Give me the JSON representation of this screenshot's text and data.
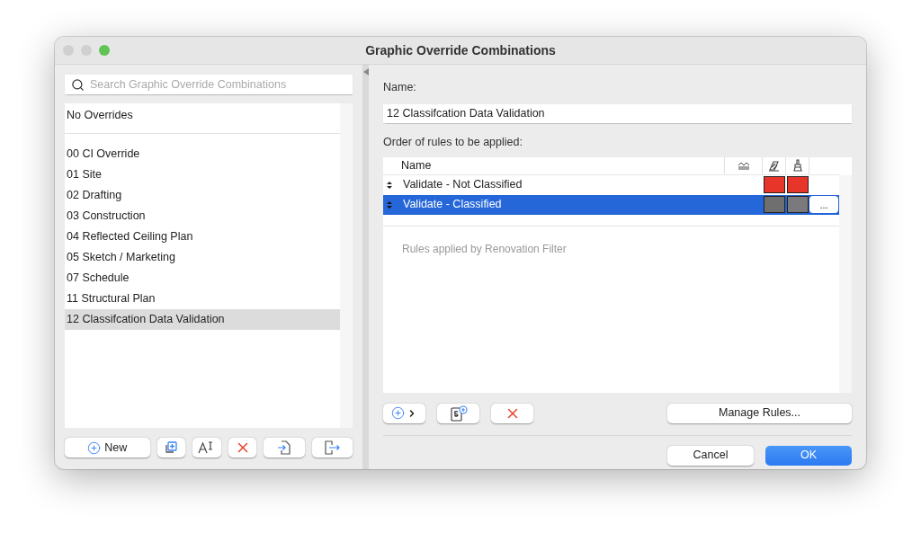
{
  "window": {
    "title": "Graphic Override Combinations"
  },
  "search": {
    "placeholder": "Search Graphic Override Combinations"
  },
  "combinations": [
    {
      "label": "No Overrides",
      "selected": false,
      "kind": "special"
    },
    {
      "label": "00 CI Override",
      "selected": false,
      "kind": "item"
    },
    {
      "label": "01 Site",
      "selected": false,
      "kind": "item"
    },
    {
      "label": "02 Drafting",
      "selected": false,
      "kind": "item"
    },
    {
      "label": "03 Construction",
      "selected": false,
      "kind": "item"
    },
    {
      "label": "04 Reflected Ceiling Plan",
      "selected": false,
      "kind": "item"
    },
    {
      "label": "05 Sketch / Marketing",
      "selected": false,
      "kind": "item"
    },
    {
      "label": "07 Schedule",
      "selected": false,
      "kind": "item"
    },
    {
      "label": "11 Structural Plan",
      "selected": false,
      "kind": "item"
    },
    {
      "label": "12 Classifcation Data Validation",
      "selected": true,
      "kind": "item"
    }
  ],
  "left_toolbar": {
    "new_button": "New"
  },
  "name_label": "Name:",
  "name_value": "12 Classifcation Data Validation",
  "rules_label": "Order of rules to be applied:",
  "rules_table": {
    "column_name": "Name",
    "rows": [
      {
        "name": "Validate - Not Classified",
        "selected": false,
        "swatches": [
          {
            "color": "#e8352a"
          },
          {
            "color": "#e8352a"
          }
        ]
      },
      {
        "name": "Validate - Classified",
        "selected": true,
        "swatches": [
          {
            "color": "#6f6f6f"
          },
          {
            "color": "#7a7a7c"
          }
        ],
        "more": "..."
      }
    ],
    "renovation_note": "Rules applied by Renovation Filter"
  },
  "manage_rules_button": "Manage Rules...",
  "cancel_button": "Cancel",
  "ok_button": "OK"
}
